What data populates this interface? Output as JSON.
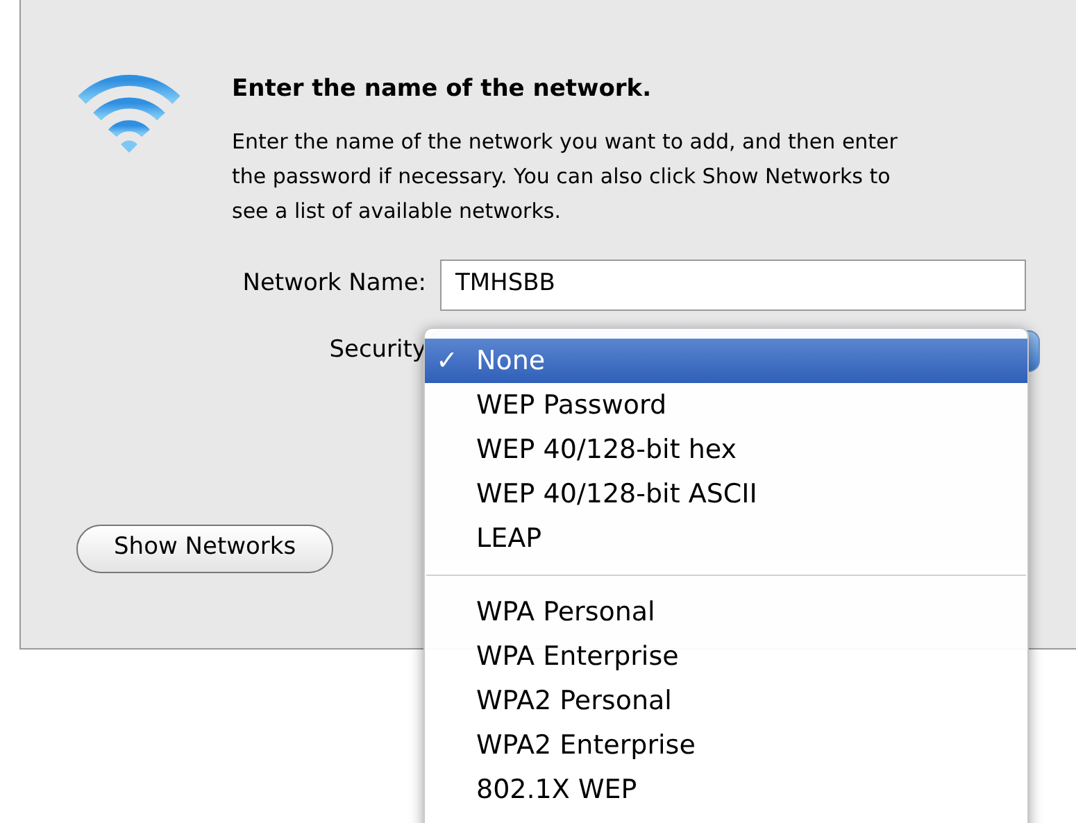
{
  "dialog": {
    "title": "Enter the name of the network.",
    "message": "Enter the name of the network you want to add, and then enter the password if necessary. You can also click Show Networks to see a list of available networks.",
    "network_name": {
      "label": "Network Name:",
      "value": "TMHSBB"
    },
    "security": {
      "label": "Security"
    },
    "buttons": [
      {
        "label": "Show Networks",
        "kind": "plain"
      }
    ]
  },
  "security_menu": {
    "groups": [
      [
        {
          "label": "None",
          "selected": true
        },
        {
          "label": "WEP Password",
          "selected": false
        },
        {
          "label": "WEP 40/128-bit hex",
          "selected": false
        },
        {
          "label": "WEP 40/128-bit ASCII",
          "selected": false
        },
        {
          "label": "LEAP",
          "selected": false
        }
      ],
      [
        {
          "label": "WPA Personal",
          "selected": false
        },
        {
          "label": "WPA Enterprise",
          "selected": false
        },
        {
          "label": "WPA2 Personal",
          "selected": false
        },
        {
          "label": "WPA2 Enterprise",
          "selected": false
        },
        {
          "label": "802.1X WEP",
          "selected": false
        }
      ]
    ],
    "check_mark": "✓"
  }
}
